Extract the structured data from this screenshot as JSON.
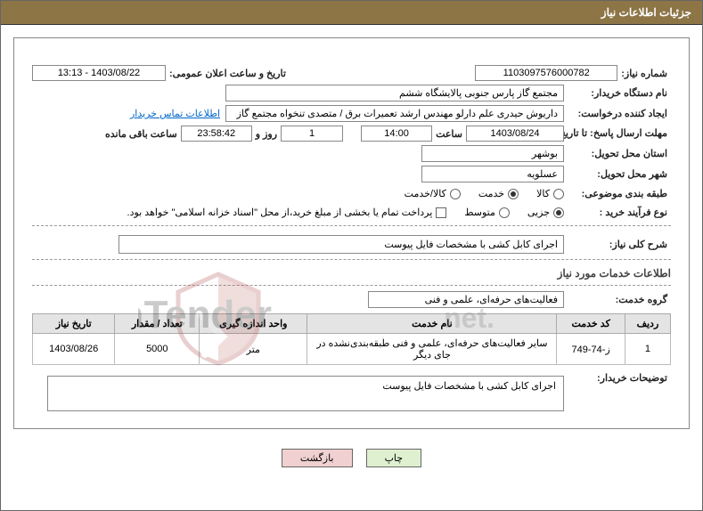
{
  "header": {
    "title": "جزئیات اطلاعات نیاز"
  },
  "need": {
    "number_label": "شماره نیاز:",
    "number": "1103097576000782",
    "public_date_label": "تاریخ و ساعت اعلان عمومی:",
    "public_date": "1403/08/22 - 13:13"
  },
  "buyer_org": {
    "label": "نام دستگاه خریدار:",
    "value": "مجتمع گاز پارس جنوبی  پالایشگاه ششم"
  },
  "requester": {
    "label": "ایجاد کننده درخواست:",
    "value": "داریوش حیدری علم دارلو مهندس ارشد تعمیرات برق / متصدی تنخواه مجتمع گاز",
    "contact_link": "اطلاعات تماس خریدار"
  },
  "deadline": {
    "label1": "مهلت ارسال پاسخ:",
    "label2": "تا تاریخ:",
    "date": "1403/08/24",
    "time_label": "ساعت",
    "time": "14:00",
    "days": "1",
    "days_label": "روز و",
    "hours": "23:58:42",
    "remain_label": "ساعت باقی مانده"
  },
  "province": {
    "label": "استان محل تحویل:",
    "value": "بوشهر"
  },
  "city": {
    "label": "شهر محل تحویل:",
    "value": "عسلویه"
  },
  "category": {
    "label": "طبقه بندی موضوعی:",
    "opt_goods": "کالا",
    "opt_service": "خدمت",
    "opt_both": "کالا/خدمت"
  },
  "process": {
    "label": "نوع فرآیند خرید :",
    "opt_minor": "جزیی",
    "opt_medium": "متوسط",
    "payment_note": "پرداخت تمام یا بخشی از مبلغ خرید،از محل \"اسناد خزانه اسلامی\" خواهد بود."
  },
  "summary": {
    "label": "شرح کلی نیاز:",
    "value": "اجرای کابل کشی با مشخصات فایل پیوست"
  },
  "services_section": "اطلاعات خدمات مورد نیاز",
  "service_group": {
    "label": "گروه خدمت:",
    "value": "فعالیت‌های حرفه‌ای، علمی و فنی"
  },
  "table": {
    "headers": {
      "row": "ردیف",
      "code": "کد خدمت",
      "name": "نام خدمت",
      "unit": "واحد اندازه گیری",
      "qty": "تعداد / مقدار",
      "need_date": "تاریخ نیاز"
    },
    "rows": [
      {
        "row": "1",
        "code": "ز-74-749",
        "name": "سایر فعالیت‌های حرفه‌ای، علمی و فنی طبقه‌بندی‌نشده در جای دیگر",
        "unit": "متر",
        "qty": "5000",
        "need_date": "1403/08/26"
      }
    ]
  },
  "buyer_notes": {
    "label": "توضیحات خریدار:",
    "value": "اجرای کابل کشی با مشخصات فایل پیوست"
  },
  "buttons": {
    "print": "چاپ",
    "back": "بازگشت"
  },
  "watermark_text": "AriaTender.net"
}
